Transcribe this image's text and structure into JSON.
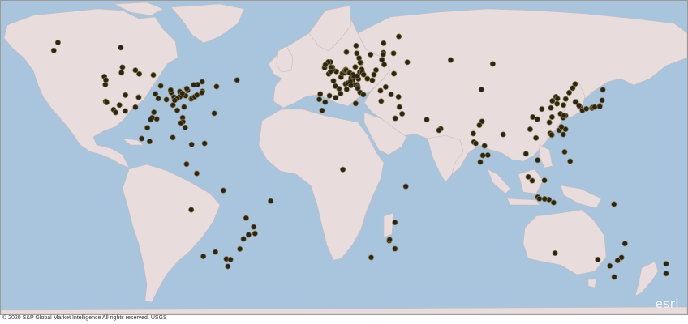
{
  "map": {
    "basemap": "light gray canvas",
    "colors": {
      "water": "#a9c4dd",
      "land": "#e8dcdc",
      "marker": "#2b2418",
      "marker_stroke": "#8a7a40",
      "border": "#cdbdbd"
    },
    "markers": [
      [
        49.2,
        -123.1
      ],
      [
        53.5,
        -113.5
      ],
      [
        51.0,
        -114.0
      ],
      [
        47.6,
        -122.3
      ],
      [
        45.5,
        -122.6
      ],
      [
        37.8,
        -122.4
      ],
      [
        37.3,
        -121.9
      ],
      [
        34.0,
        -118.2
      ],
      [
        32.7,
        -117.1
      ],
      [
        33.4,
        -112.0
      ],
      [
        36.1,
        -115.1
      ],
      [
        39.7,
        -104.9
      ],
      [
        40.7,
        -111.9
      ],
      [
        35.1,
        -106.6
      ],
      [
        29.7,
        -95.3
      ],
      [
        32.8,
        -96.8
      ],
      [
        30.3,
        -97.7
      ],
      [
        29.4,
        -98.5
      ],
      [
        41.8,
        -87.6
      ],
      [
        44.9,
        -93.2
      ],
      [
        39.1,
        -94.5
      ],
      [
        38.6,
        -90.2
      ],
      [
        43.0,
        -87.9
      ],
      [
        41.2,
        -96.0
      ],
      [
        36.1,
        -86.7
      ],
      [
        33.7,
        -84.4
      ],
      [
        35.2,
        -80.8
      ],
      [
        30.3,
        -81.6
      ],
      [
        28.5,
        -81.4
      ],
      [
        25.8,
        -80.2
      ],
      [
        27.9,
        -82.5
      ],
      [
        38.9,
        -77.0
      ],
      [
        39.3,
        -76.6
      ],
      [
        39.9,
        -75.2
      ],
      [
        40.7,
        -74.0
      ],
      [
        42.4,
        -71.1
      ],
      [
        41.8,
        -71.4
      ],
      [
        42.9,
        -78.9
      ],
      [
        40.4,
        -80.0
      ],
      [
        39.9,
        -83.0
      ],
      [
        42.3,
        -83.0
      ],
      [
        41.5,
        -81.7
      ],
      [
        39.8,
        -86.2
      ],
      [
        39.1,
        -84.5
      ],
      [
        38.3,
        -85.8
      ],
      [
        43.7,
        -79.4
      ],
      [
        45.5,
        -73.6
      ],
      [
        45.4,
        -75.7
      ],
      [
        46.8,
        -71.2
      ],
      [
        44.6,
        -63.6
      ],
      [
        47.6,
        -52.7
      ],
      [
        49.9,
        -97.1
      ],
      [
        50.4,
        -104.6
      ],
      [
        52.1,
        -106.6
      ],
      [
        62.5,
        -114.4
      ],
      [
        61.2,
        -149.9
      ],
      [
        64.8,
        -147.7
      ],
      [
        32.3,
        -64.8
      ],
      [
        19.4,
        -99.1
      ],
      [
        20.7,
        -103.3
      ],
      [
        25.7,
        -100.3
      ],
      [
        21.2,
        -86.8
      ],
      [
        18.5,
        -69.9
      ],
      [
        18.0,
        -76.8
      ],
      [
        9.0,
        -79.5
      ],
      [
        4.7,
        -74.1
      ],
      [
        -12.0,
        -77.0
      ],
      [
        -33.4,
        -70.6
      ],
      [
        -34.6,
        -58.4
      ],
      [
        -31.4,
        -64.2
      ],
      [
        -34.9,
        -56.2
      ],
      [
        -23.5,
        -46.6
      ],
      [
        -22.9,
        -43.2
      ],
      [
        -19.9,
        -43.9
      ],
      [
        -15.8,
        -47.9
      ],
      [
        -25.4,
        -49.3
      ],
      [
        -30.0,
        -51.2
      ],
      [
        -8.0,
        -34.9
      ],
      [
        -3.1,
        -60.0
      ],
      [
        -38.0,
        -57.6
      ],
      [
        51.5,
        -0.1
      ],
      [
        52.5,
        -1.9
      ],
      [
        53.5,
        -2.2
      ],
      [
        53.4,
        -2.9
      ],
      [
        55.9,
        -3.2
      ],
      [
        55.9,
        -4.3
      ],
      [
        53.3,
        -6.3
      ],
      [
        50.4,
        -4.1
      ],
      [
        51.5,
        -3.2
      ],
      [
        54.6,
        -5.9
      ],
      [
        48.9,
        2.4
      ],
      [
        45.8,
        4.8
      ],
      [
        43.3,
        5.4
      ],
      [
        43.6,
        1.4
      ],
      [
        44.8,
        -0.6
      ],
      [
        47.2,
        -1.6
      ],
      [
        50.6,
        3.1
      ],
      [
        48.6,
        7.8
      ],
      [
        50.9,
        4.4
      ],
      [
        52.4,
        4.9
      ],
      [
        51.9,
        4.5
      ],
      [
        52.1,
        5.1
      ],
      [
        51.2,
        6.8
      ],
      [
        50.9,
        7.0
      ],
      [
        50.1,
        8.7
      ],
      [
        48.8,
        9.2
      ],
      [
        48.1,
        11.6
      ],
      [
        49.5,
        11.1
      ],
      [
        52.5,
        13.4
      ],
      [
        53.6,
        10.0
      ],
      [
        51.3,
        12.4
      ],
      [
        51.1,
        13.7
      ],
      [
        47.4,
        8.5
      ],
      [
        46.2,
        6.1
      ],
      [
        46.9,
        7.4
      ],
      [
        48.2,
        16.4
      ],
      [
        50.1,
        14.4
      ],
      [
        52.2,
        21.0
      ],
      [
        50.1,
        19.9
      ],
      [
        47.5,
        19.0
      ],
      [
        45.5,
        9.2
      ],
      [
        45.1,
        7.7
      ],
      [
        45.4,
        11.0
      ],
      [
        44.5,
        11.3
      ],
      [
        43.8,
        11.3
      ],
      [
        41.9,
        12.5
      ],
      [
        40.9,
        14.3
      ],
      [
        40.4,
        -3.7
      ],
      [
        41.4,
        2.2
      ],
      [
        39.5,
        -0.4
      ],
      [
        37.4,
        -6.0
      ],
      [
        38.7,
        -9.1
      ],
      [
        41.2,
        -8.6
      ],
      [
        59.9,
        10.8
      ],
      [
        59.3,
        18.1
      ],
      [
        57.7,
        12.0
      ],
      [
        55.6,
        13.0
      ],
      [
        55.7,
        12.6
      ],
      [
        60.2,
        24.9
      ],
      [
        59.4,
        24.8
      ],
      [
        56.9,
        24.1
      ],
      [
        54.7,
        25.3
      ],
      [
        63.4,
        10.4
      ],
      [
        60.4,
        5.3
      ],
      [
        64.5,
        25.0
      ],
      [
        55.8,
        37.6
      ],
      [
        59.9,
        30.3
      ],
      [
        50.5,
        30.5
      ],
      [
        44.4,
        26.1
      ],
      [
        42.7,
        23.3
      ],
      [
        37.9,
        23.7
      ],
      [
        41.0,
        29.0
      ],
      [
        39.9,
        32.9
      ],
      [
        35.2,
        33.4
      ],
      [
        32.1,
        34.8
      ],
      [
        25.2,
        55.3
      ],
      [
        24.5,
        54.4
      ],
      [
        29.4,
        47.9
      ],
      [
        56.8,
        60.6
      ],
      [
        55.0,
        82.9
      ],
      [
        43.2,
        76.9
      ],
      [
        67.6,
        33.1
      ],
      [
        19.1,
        72.9
      ],
      [
        18.5,
        73.9
      ],
      [
        28.6,
        77.2
      ],
      [
        26.9,
        75.8
      ],
      [
        23.0,
        72.6
      ],
      [
        22.6,
        88.4
      ],
      [
        17.4,
        78.5
      ],
      [
        13.1,
        80.3
      ],
      [
        12.97,
        77.6
      ],
      [
        9.9,
        76.3
      ],
      [
        13.7,
        100.5
      ],
      [
        21.0,
        105.8
      ],
      [
        10.8,
        106.7
      ],
      [
        3.1,
        101.7
      ],
      [
        1.35,
        103.8
      ],
      [
        -6.2,
        106.8
      ],
      [
        -7.3,
        112.7
      ],
      [
        -8.7,
        115.2
      ],
      [
        -6.9,
        107.6
      ],
      [
        -7.0,
        110.4
      ],
      [
        14.6,
        121.0
      ],
      [
        10.3,
        123.9
      ],
      [
        1.5,
        110.3
      ],
      [
        22.3,
        114.2
      ],
      [
        23.1,
        113.3
      ],
      [
        22.5,
        114.1
      ],
      [
        25.0,
        121.5
      ],
      [
        22.6,
        120.3
      ],
      [
        24.5,
        118.1
      ],
      [
        26.1,
        119.3
      ],
      [
        31.2,
        121.5
      ],
      [
        30.3,
        120.2
      ],
      [
        32.1,
        118.8
      ],
      [
        31.3,
        120.6
      ],
      [
        39.9,
        116.4
      ],
      [
        39.1,
        117.2
      ],
      [
        36.1,
        120.4
      ],
      [
        36.7,
        117.0
      ],
      [
        34.3,
        108.9
      ],
      [
        30.6,
        104.1
      ],
      [
        29.6,
        106.5
      ],
      [
        30.6,
        114.3
      ],
      [
        28.2,
        112.9
      ],
      [
        38.0,
        114.5
      ],
      [
        41.8,
        123.4
      ],
      [
        38.9,
        121.6
      ],
      [
        45.8,
        126.6
      ],
      [
        43.9,
        125.3
      ],
      [
        34.8,
        113.7
      ],
      [
        25.0,
        102.7
      ],
      [
        37.6,
        127.0
      ],
      [
        35.2,
        129.1
      ],
      [
        35.9,
        128.6
      ],
      [
        37.5,
        126.7
      ],
      [
        35.7,
        139.7
      ],
      [
        35.4,
        139.6
      ],
      [
        34.7,
        135.5
      ],
      [
        35.0,
        135.8
      ],
      [
        35.2,
        136.9
      ],
      [
        33.6,
        130.4
      ],
      [
        43.1,
        141.3
      ],
      [
        38.3,
        140.9
      ],
      [
        34.4,
        132.5
      ],
      [
        -33.9,
        151.2
      ],
      [
        -37.8,
        145.0
      ],
      [
        -27.5,
        153.0
      ],
      [
        -31.9,
        115.9
      ],
      [
        -34.9,
        138.6
      ],
      [
        -35.3,
        149.1
      ],
      [
        -42.9,
        147.3
      ],
      [
        -36.8,
        174.8
      ],
      [
        -41.3,
        174.8
      ],
      [
        -26.2,
        28.0
      ],
      [
        -33.9,
        18.4
      ],
      [
        -29.9,
        31.0
      ],
      [
        -25.7,
        28.2
      ],
      [
        6.5,
        3.4
      ],
      [
        -1.3,
        36.8
      ],
      [
        30.0,
        31.2
      ],
      [
        33.6,
        -7.6
      ],
      [
        36.8,
        10.2
      ],
      [
        -9.4,
        147.2
      ],
      [
        -17.8,
        31.0
      ]
    ]
  },
  "attribution": "© 2020 S&P Global Market Intelligence All rights reserved. USGS",
  "logo": {
    "text": "esri"
  }
}
